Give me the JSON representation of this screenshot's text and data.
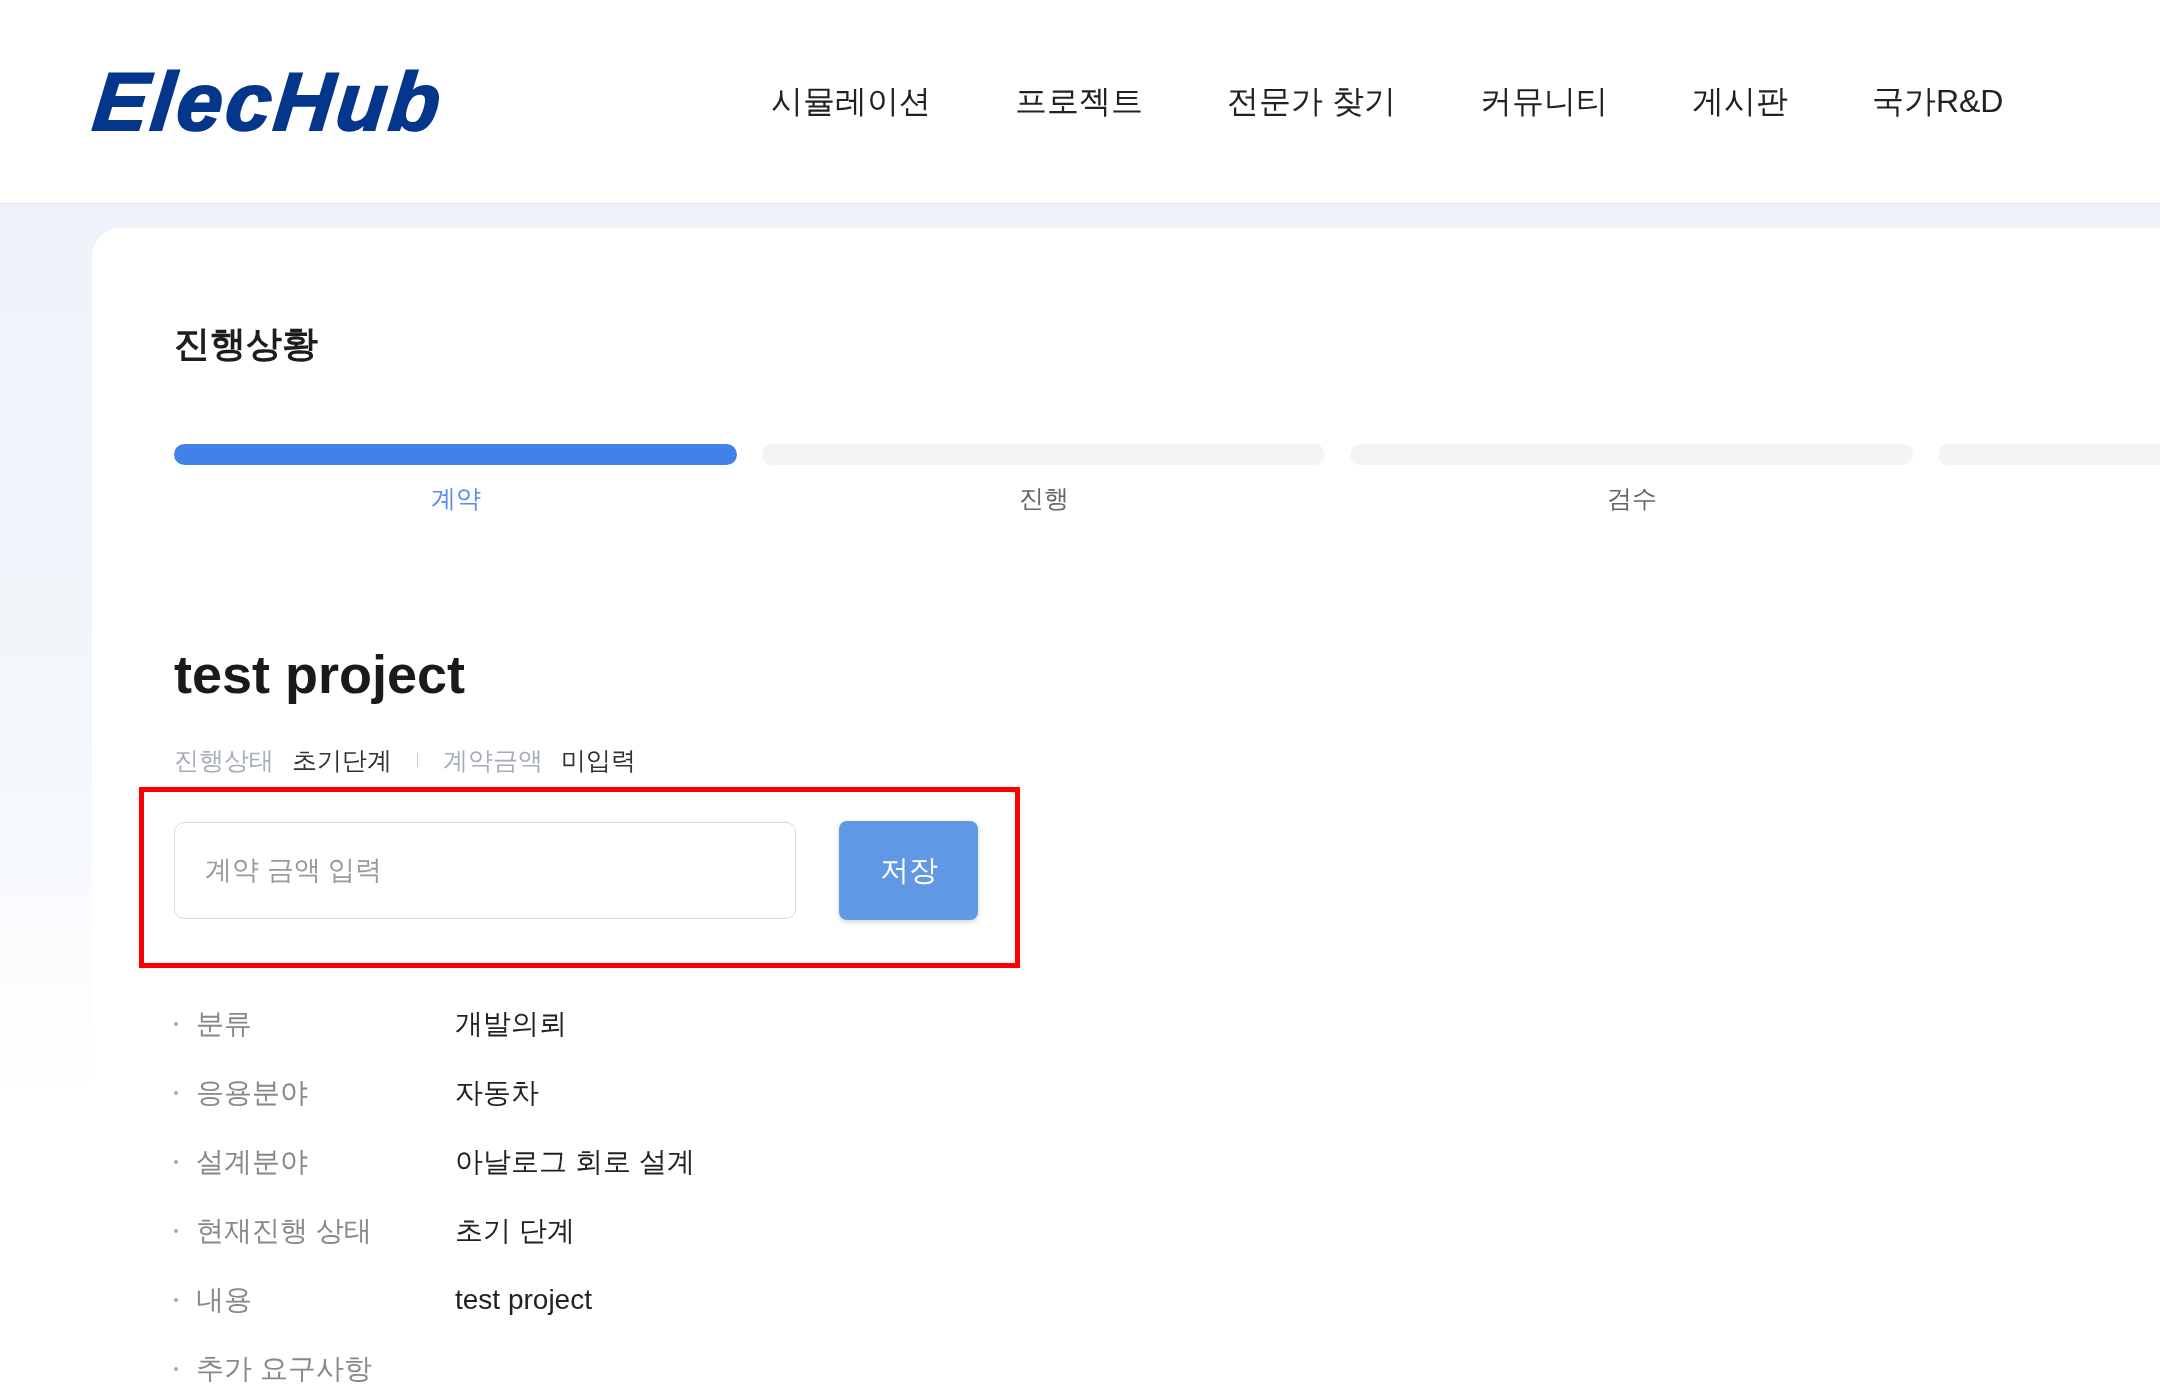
{
  "header": {
    "logo": "ElecHub",
    "nav": [
      "시뮬레이션",
      "프로젝트",
      "전문가 찾기",
      "커뮤니티",
      "게시판",
      "국가R&D"
    ]
  },
  "progress": {
    "title": "진행상황",
    "steps": [
      {
        "label": "계약",
        "active": true
      },
      {
        "label": "진행",
        "active": false
      },
      {
        "label": "검수",
        "active": false
      },
      {
        "active": false
      }
    ]
  },
  "project": {
    "title": "test project",
    "meta": [
      {
        "label": "진행상태",
        "value": "초기단계"
      },
      {
        "label": "계약금액",
        "value": "미입력"
      }
    ],
    "amount_form": {
      "highlighted": true,
      "placeholder": "계약 금액 입력",
      "button": "저장"
    },
    "details": [
      {
        "label": "분류",
        "value": "개발의뢰"
      },
      {
        "label": "응용분야",
        "value": "자동차"
      },
      {
        "label": "설계분야",
        "value": "아날로그 회로 설계"
      },
      {
        "label": "현재진행 상태",
        "value": "초기 단계"
      },
      {
        "label": "내용",
        "value": "test project"
      },
      {
        "label": "추가 요구사항"
      }
    ]
  }
}
